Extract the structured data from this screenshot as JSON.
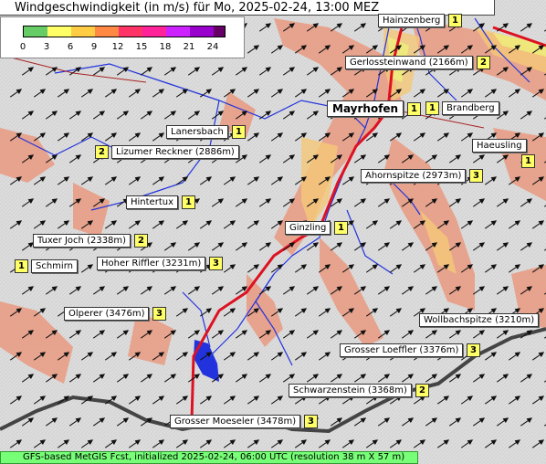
{
  "title": "Windgeschwindigkeit (in m/s) für Mo, 2025-02-24, 13:00 MEZ",
  "legend": {
    "ticks": [
      "0",
      "3",
      "6",
      "9",
      "12",
      "15",
      "18",
      "21",
      "24"
    ],
    "colors": [
      "#66cc66",
      "#ffff66",
      "#ffcc44",
      "#ff8844",
      "#ff3366",
      "#ff2299",
      "#cc22ff",
      "#9900cc",
      "#660066"
    ]
  },
  "places": [
    {
      "name": "Hainzenberg",
      "value": "1"
    },
    {
      "name": "Gerlossteinwand (2166m)",
      "value": "2"
    },
    {
      "name": "Mayrhofen",
      "value": "1"
    },
    {
      "name": "Brandberg",
      "value": "1"
    },
    {
      "name": "Lanersbach",
      "value": "1"
    },
    {
      "name": "Lizumer Reckner (2886m)",
      "value": "2"
    },
    {
      "name": "Haeusling",
      "value": "1"
    },
    {
      "name": "Ahornspitze (2973m)",
      "value": "3"
    },
    {
      "name": "Hintertux",
      "value": "1"
    },
    {
      "name": "Ginzling",
      "value": "1"
    },
    {
      "name": "Tuxer Joch (2338m)",
      "value": "2"
    },
    {
      "name": "Schmirn",
      "value": "1"
    },
    {
      "name": "Hoher Riffler (3231m)",
      "value": "3"
    },
    {
      "name": "Olperer (3476m)",
      "value": "3"
    },
    {
      "name": "Wollbachspitze (3210m)",
      "value": ""
    },
    {
      "name": "Grosser Loeffler (3376m)",
      "value": "3"
    },
    {
      "name": "Schwarzenstein (3368m)",
      "value": "2"
    },
    {
      "name": "Grosser Moeseler (3478m)",
      "value": "3"
    }
  ],
  "footer": "GFS-based MetGIS Fcst, initialized 2025-02-24, 06:00 UTC  (resolution 38 m X 57 m)"
}
